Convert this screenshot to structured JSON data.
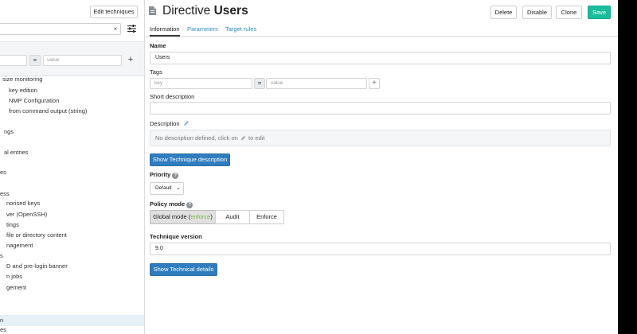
{
  "left": {
    "edit_techniques_label": "Edit techniques",
    "search_clear_glyph": "×",
    "filter": {
      "eq_glyph": "=",
      "value_placeholder": "value",
      "add_glyph": "+"
    },
    "tree_items": [
      "size monitoring",
      "key edition",
      "NMP Configuration",
      "from command output (string)",
      "ngs",
      "al entries",
      "es",
      "ess",
      "norised keys",
      "ver (OpenSSH)",
      "tings",
      "file or directory content",
      "nagement",
      "s",
      "D and pre-login banner",
      "n jobs",
      "gement",
      "n",
      "es"
    ]
  },
  "header": {
    "title_prefix": "Directive",
    "title_name": "Users",
    "buttons": {
      "delete": "Delete",
      "disable": "Disable",
      "clone": "Clone",
      "save": "Save"
    }
  },
  "tabs": {
    "information": "Information",
    "parameters": "Parameters",
    "target_rules": "Target rules"
  },
  "form": {
    "name_label": "Name",
    "name_value": "Users",
    "tags_label": "Tags",
    "tag_key_placeholder": "key",
    "tag_eq": "=",
    "tag_value_placeholder": "value",
    "tag_add": "+",
    "short_desc_label": "Short description",
    "short_desc_value": "",
    "desc_label": "Description",
    "desc_placeholder_before": "No description defined, click on",
    "desc_placeholder_after": "to edit",
    "show_technique_desc": "Show Technique description",
    "priority_label": "Priority",
    "priority_value": "Default",
    "policy_mode_label": "Policy mode",
    "policy_global_prefix": "Global mode (",
    "policy_global_mode": "enforce",
    "policy_global_suffix": ")",
    "policy_audit": "Audit",
    "policy_enforce": "Enforce",
    "technique_version_label": "Technique version",
    "technique_version_value": "9.0",
    "show_technical_details": "Show Technical details"
  },
  "colors": {
    "accent_blue": "#2f7cbf",
    "save_teal": "#1abc9c",
    "link_blue": "#2b8cbe",
    "enforce_green": "#7ab648"
  },
  "icons": {
    "filter": "sliders-icon",
    "document": "file-icon",
    "pencil": "pencil-icon",
    "help": "question-circle-icon"
  }
}
